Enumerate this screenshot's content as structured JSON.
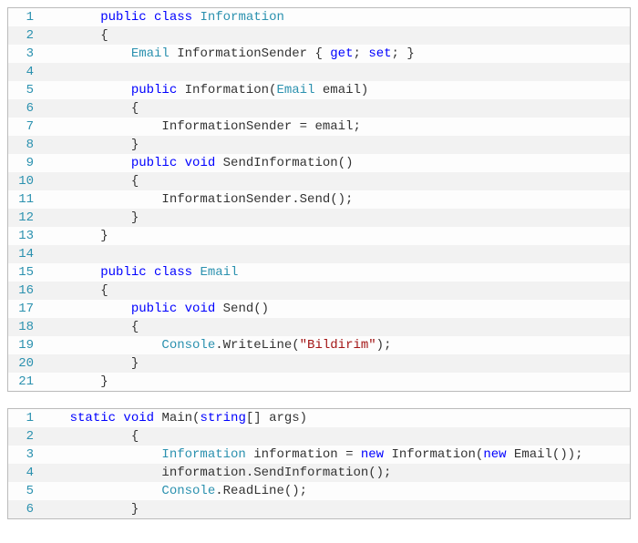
{
  "blocks": [
    {
      "id": "block1",
      "lines": [
        {
          "n": 1,
          "indent": 8,
          "tokens": [
            {
              "t": "public ",
              "c": "kw"
            },
            {
              "t": "class ",
              "c": "kw"
            },
            {
              "t": "Information",
              "c": "type"
            }
          ]
        },
        {
          "n": 2,
          "indent": 8,
          "tokens": [
            {
              "t": "{",
              "c": "plain"
            }
          ]
        },
        {
          "n": 3,
          "indent": 12,
          "tokens": [
            {
              "t": "Email ",
              "c": "type"
            },
            {
              "t": "InformationSender { ",
              "c": "plain"
            },
            {
              "t": "get",
              "c": "kw"
            },
            {
              "t": "; ",
              "c": "plain"
            },
            {
              "t": "set",
              "c": "kw"
            },
            {
              "t": "; }",
              "c": "plain"
            }
          ]
        },
        {
          "n": 4,
          "indent": 0,
          "tokens": []
        },
        {
          "n": 5,
          "indent": 12,
          "tokens": [
            {
              "t": "public ",
              "c": "kw"
            },
            {
              "t": "Information(",
              "c": "plain"
            },
            {
              "t": "Email ",
              "c": "type"
            },
            {
              "t": "email)",
              "c": "plain"
            }
          ]
        },
        {
          "n": 6,
          "indent": 12,
          "tokens": [
            {
              "t": "{",
              "c": "plain"
            }
          ]
        },
        {
          "n": 7,
          "indent": 16,
          "tokens": [
            {
              "t": "InformationSender = email;",
              "c": "plain"
            }
          ]
        },
        {
          "n": 8,
          "indent": 12,
          "tokens": [
            {
              "t": "}",
              "c": "plain"
            }
          ]
        },
        {
          "n": 9,
          "indent": 12,
          "tokens": [
            {
              "t": "public ",
              "c": "kw"
            },
            {
              "t": "void ",
              "c": "kw"
            },
            {
              "t": "SendInformation()",
              "c": "plain"
            }
          ]
        },
        {
          "n": 10,
          "indent": 12,
          "tokens": [
            {
              "t": "{",
              "c": "plain"
            }
          ]
        },
        {
          "n": 11,
          "indent": 16,
          "tokens": [
            {
              "t": "InformationSender.Send();",
              "c": "plain"
            }
          ]
        },
        {
          "n": 12,
          "indent": 12,
          "tokens": [
            {
              "t": "}",
              "c": "plain"
            }
          ]
        },
        {
          "n": 13,
          "indent": 8,
          "tokens": [
            {
              "t": "}",
              "c": "plain"
            }
          ]
        },
        {
          "n": 14,
          "indent": 0,
          "tokens": []
        },
        {
          "n": 15,
          "indent": 8,
          "tokens": [
            {
              "t": "public ",
              "c": "kw"
            },
            {
              "t": "class ",
              "c": "kw"
            },
            {
              "t": "Email",
              "c": "type"
            }
          ]
        },
        {
          "n": 16,
          "indent": 8,
          "tokens": [
            {
              "t": "{",
              "c": "plain"
            }
          ]
        },
        {
          "n": 17,
          "indent": 12,
          "tokens": [
            {
              "t": "public ",
              "c": "kw"
            },
            {
              "t": "void ",
              "c": "kw"
            },
            {
              "t": "Send()",
              "c": "plain"
            }
          ]
        },
        {
          "n": 18,
          "indent": 12,
          "tokens": [
            {
              "t": "{",
              "c": "plain"
            }
          ]
        },
        {
          "n": 19,
          "indent": 16,
          "tokens": [
            {
              "t": "Console",
              "c": "type"
            },
            {
              "t": ".WriteLine(",
              "c": "plain"
            },
            {
              "t": "\"Bildirim\"",
              "c": "str"
            },
            {
              "t": ");",
              "c": "plain"
            }
          ]
        },
        {
          "n": 20,
          "indent": 12,
          "tokens": [
            {
              "t": "}",
              "c": "plain"
            }
          ]
        },
        {
          "n": 21,
          "indent": 8,
          "tokens": [
            {
              "t": "}",
              "c": "plain"
            }
          ]
        }
      ]
    },
    {
      "id": "block2",
      "lines": [
        {
          "n": 1,
          "indent": 4,
          "tokens": [
            {
              "t": "static ",
              "c": "kw"
            },
            {
              "t": "void ",
              "c": "kw"
            },
            {
              "t": "Main(",
              "c": "plain"
            },
            {
              "t": "string",
              "c": "kw"
            },
            {
              "t": "[] args)",
              "c": "plain"
            }
          ]
        },
        {
          "n": 2,
          "indent": 12,
          "tokens": [
            {
              "t": "{",
              "c": "plain"
            }
          ]
        },
        {
          "n": 3,
          "indent": 16,
          "tokens": [
            {
              "t": "Information ",
              "c": "type"
            },
            {
              "t": "information = ",
              "c": "plain"
            },
            {
              "t": "new ",
              "c": "kw"
            },
            {
              "t": "Information(",
              "c": "plain"
            },
            {
              "t": "new ",
              "c": "kw"
            },
            {
              "t": "Email());",
              "c": "plain"
            }
          ]
        },
        {
          "n": 4,
          "indent": 16,
          "tokens": [
            {
              "t": "information.SendInformation();",
              "c": "plain"
            }
          ]
        },
        {
          "n": 5,
          "indent": 16,
          "tokens": [
            {
              "t": "Console",
              "c": "type"
            },
            {
              "t": ".ReadLine();",
              "c": "plain"
            }
          ]
        },
        {
          "n": 6,
          "indent": 12,
          "tokens": [
            {
              "t": "}",
              "c": "plain"
            }
          ]
        }
      ]
    }
  ]
}
